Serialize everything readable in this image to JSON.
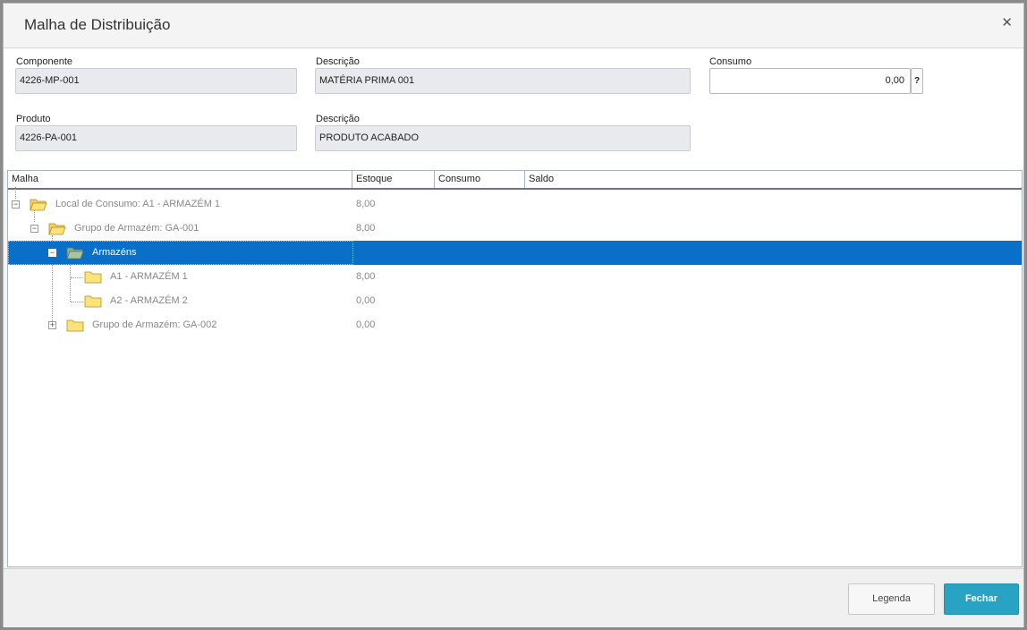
{
  "dialog": {
    "title": "Malha de Distribuição"
  },
  "form": {
    "componente": {
      "label": "Componente",
      "value": "4226-MP-001"
    },
    "descricao1": {
      "label": "Descrição",
      "value": "MATÉRIA PRIMA 001"
    },
    "consumo": {
      "label": "Consumo",
      "value": "0,00",
      "help": "?"
    },
    "produto": {
      "label": "Produto",
      "value": "4226-PA-001"
    },
    "descricao2": {
      "label": "Descrição",
      "value": "PRODUTO ACABADO"
    }
  },
  "grid": {
    "columns": [
      "Malha",
      "Estoque",
      "Consumo",
      "Saldo"
    ],
    "rows": [
      {
        "label": "Local de Consumo: A1 - ARMAZÉM 1",
        "estoque": "8,00",
        "expander": "−",
        "folder": "open-folder-icon"
      },
      {
        "label": "Grupo de Armazém: GA-001",
        "estoque": "8,00",
        "expander": "−",
        "folder": "open-folder-icon"
      },
      {
        "label": "Armazéns",
        "estoque": "",
        "expander": "−",
        "folder": "open-folder-icon",
        "selected": true
      },
      {
        "label": "A1 - ARMAZÉM 1",
        "estoque": "8,00",
        "folder": "closed-folder-icon"
      },
      {
        "label": "A2 - ARMAZÉM 2",
        "estoque": "0,00",
        "folder": "closed-folder-icon"
      },
      {
        "label": "Grupo de Armazém: GA-002",
        "estoque": "0,00",
        "expander": "+",
        "folder": "closed-folder-icon"
      }
    ]
  },
  "footer": {
    "legenda": "Legenda",
    "fechar": "Fechar"
  },
  "colors": {
    "selection": "#0a6fc9",
    "primary_button": "#29a3c4"
  }
}
